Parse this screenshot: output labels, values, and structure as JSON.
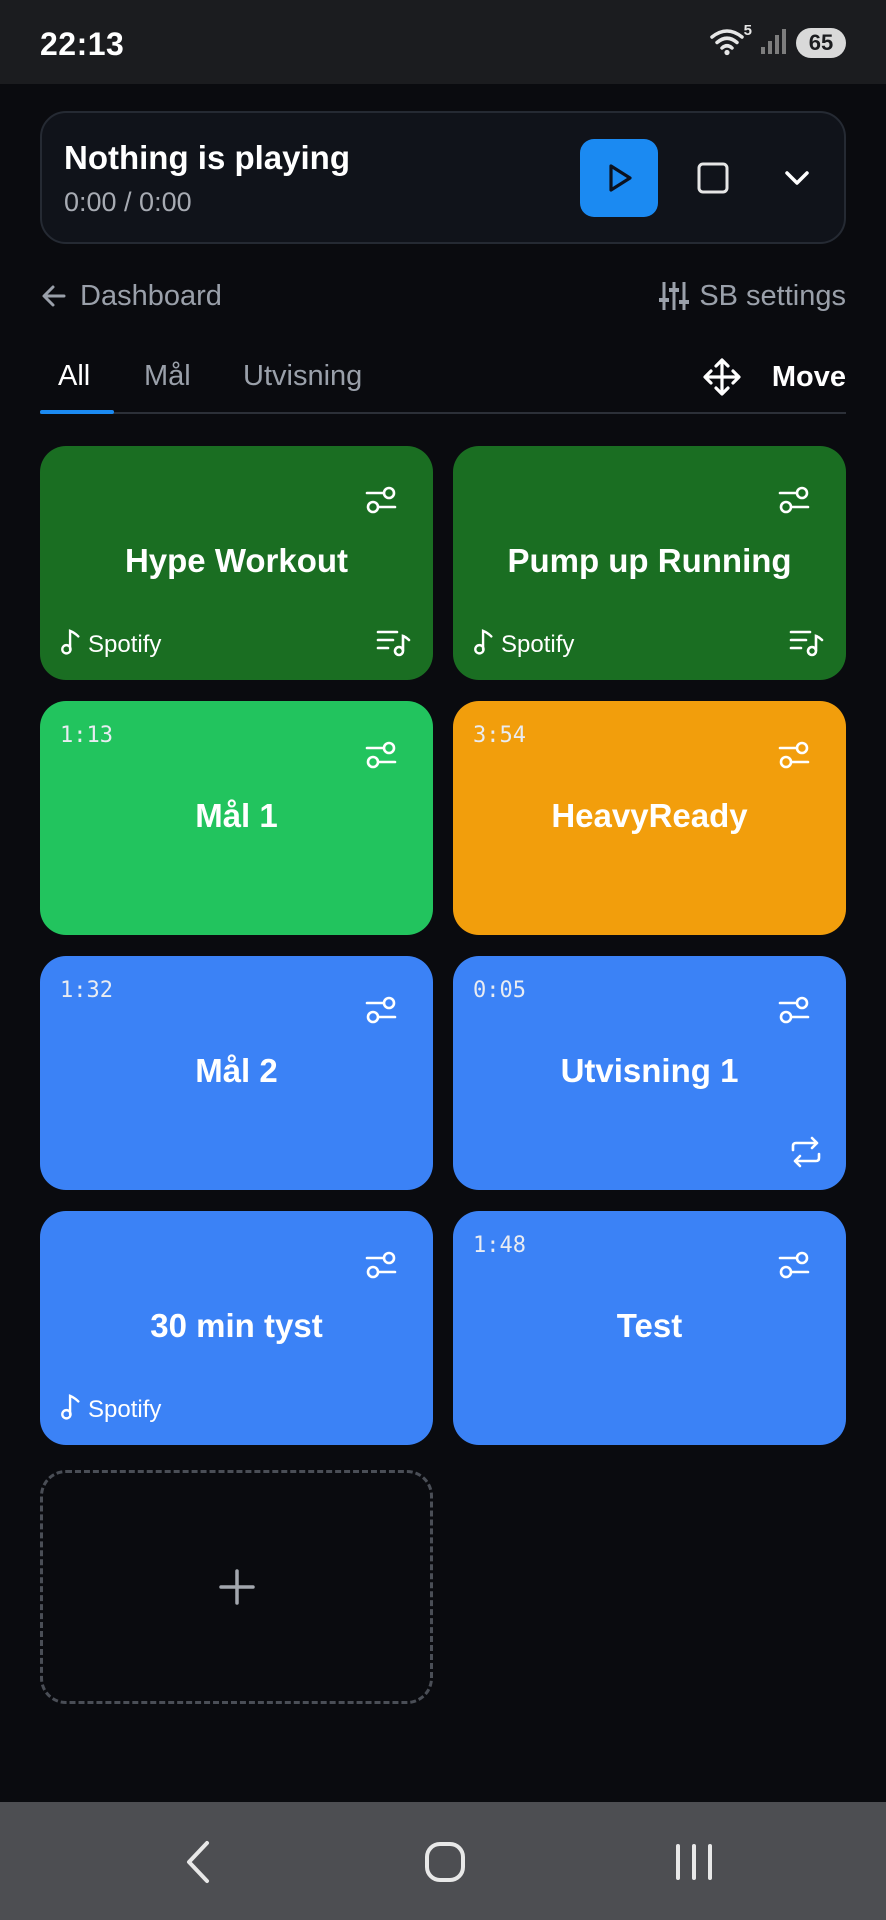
{
  "status_bar": {
    "time": "22:13",
    "wifi_badge": "5",
    "battery": "65"
  },
  "player": {
    "title": "Nothing is playing",
    "time": "0:00 / 0:00",
    "accent": "#1b8af2"
  },
  "nav": {
    "back_label": "Dashboard",
    "settings_label": "SB settings"
  },
  "tabs": [
    {
      "label": "All",
      "active": true
    },
    {
      "label": "Mål",
      "active": false
    },
    {
      "label": "Utvisning",
      "active": false
    }
  ],
  "move_label": "Move",
  "tiles": [
    {
      "name": "Hype Workout",
      "time": "",
      "source": "Spotify",
      "color": "#1a6e22",
      "corner_icon": "playlist-icon"
    },
    {
      "name": "Pump up Running",
      "time": "",
      "source": "Spotify",
      "color": "#1a6e22",
      "corner_icon": "playlist-icon"
    },
    {
      "name": "Mål 1",
      "time": "1:13",
      "source": "",
      "color": "#22c45e",
      "corner_icon": ""
    },
    {
      "name": "HeavyReady",
      "time": "3:54",
      "source": "",
      "color": "#f29e0c",
      "corner_icon": ""
    },
    {
      "name": "Mål 2",
      "time": "1:32",
      "source": "",
      "color": "#3b82f6",
      "corner_icon": ""
    },
    {
      "name": "Utvisning 1",
      "time": "0:05",
      "source": "",
      "color": "#3b82f6",
      "corner_icon": "repeat-icon"
    },
    {
      "name": "30 min tyst",
      "time": "",
      "source": "Spotify",
      "color": "#3b82f6",
      "corner_icon": ""
    },
    {
      "name": "Test",
      "time": "1:48",
      "source": "",
      "color": "#3b82f6",
      "corner_icon": ""
    }
  ]
}
